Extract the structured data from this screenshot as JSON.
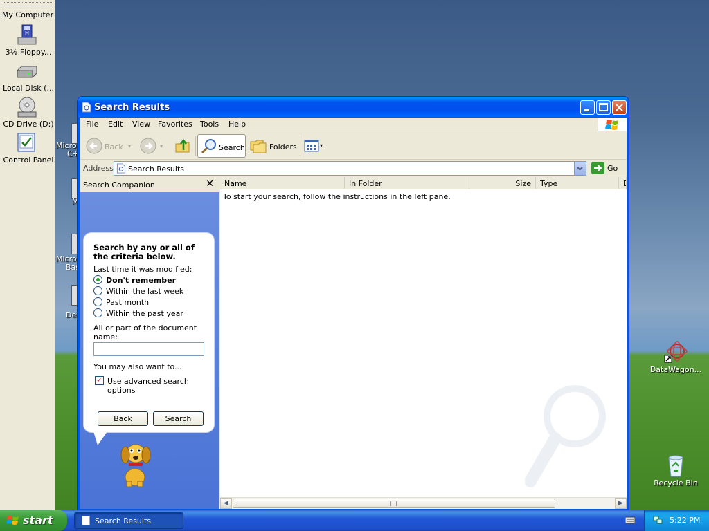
{
  "desktop": {
    "left_pane": {
      "title": "My Computer",
      "items": [
        {
          "label": "3½ Floppy...",
          "icon": "floppy-drive-icon"
        },
        {
          "label": "Local Disk (...",
          "icon": "hard-disk-icon"
        },
        {
          "label": "CD Drive (D:)",
          "icon": "cd-drive-icon"
        },
        {
          "label": "Control Panel",
          "icon": "control-panel-icon"
        }
      ]
    },
    "hidden_icon_fragments": [
      "Micros",
      "C+",
      "M",
      "Micros",
      "Bas",
      "De"
    ],
    "right_icons": [
      {
        "label": "DataWagon...",
        "icon": "datawagon-shortcut-icon"
      },
      {
        "label": "Recycle Bin",
        "icon": "recycle-bin-icon"
      }
    ]
  },
  "window": {
    "title": "Search Results",
    "menu": [
      "File",
      "Edit",
      "View",
      "Favorites",
      "Tools",
      "Help"
    ],
    "toolbar": {
      "back_label": "Back",
      "search_label": "Search",
      "folders_label": "Folders"
    },
    "address": {
      "label": "Address",
      "value": "Search Results",
      "go_label": "Go"
    },
    "companion": {
      "header": "Search Companion",
      "close_glyph": "✕",
      "title": "Search by any or all of the criteria below.",
      "modified_label": "Last time it was modified:",
      "options": [
        "Don't remember",
        "Within the last week",
        "Past month",
        "Within the past year"
      ],
      "selected_index": 0,
      "doc_name_label": "All or part of the document name:",
      "doc_name_value": "",
      "also_label": "You may also want to...",
      "advanced_label": "Use advanced search options",
      "advanced_checked": true,
      "back_button": "Back",
      "search_button": "Search"
    },
    "results": {
      "columns": [
        "Name",
        "In Folder",
        "Size",
        "Type",
        "D"
      ],
      "message": "To start your search, follow the instructions in the left pane."
    }
  },
  "taskbar": {
    "start_label": "start",
    "task_label": "Search Results",
    "clock": "5:22 PM"
  }
}
